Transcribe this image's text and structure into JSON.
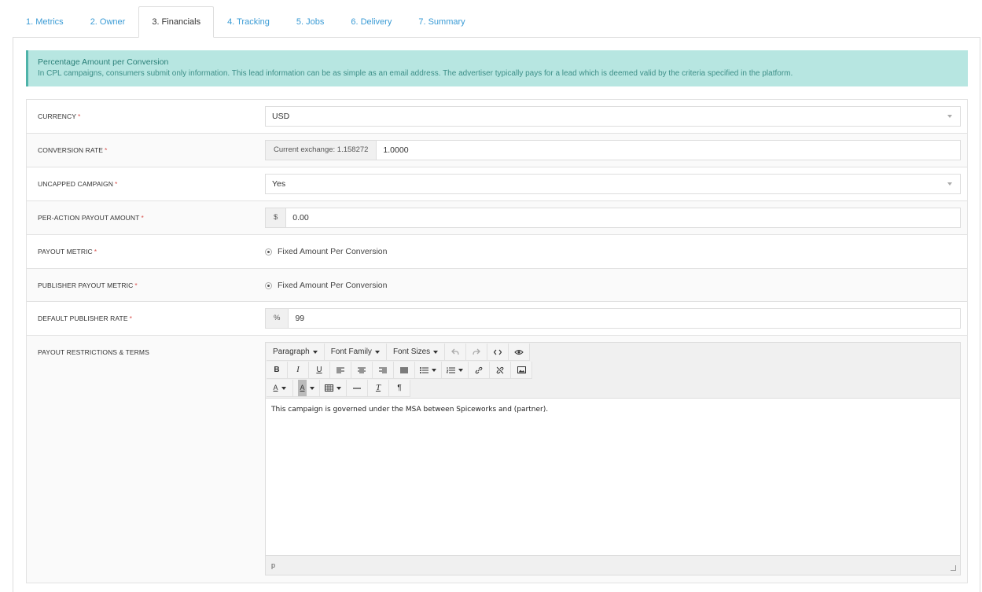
{
  "tabs": [
    {
      "label": "1. Metrics"
    },
    {
      "label": "2. Owner"
    },
    {
      "label": "3. Financials"
    },
    {
      "label": "4. Tracking"
    },
    {
      "label": "5. Jobs"
    },
    {
      "label": "6. Delivery"
    },
    {
      "label": "7. Summary"
    }
  ],
  "alert": {
    "title": "Percentage Amount per Conversion",
    "text": "In CPL campaigns, consumers submit only information. This lead information can be as simple as an email address. The advertiser typically pays for a lead which is deemed valid by the criteria specified in the platform."
  },
  "form": {
    "required_mark": "*",
    "currency": {
      "label": "CURRENCY",
      "value": "USD"
    },
    "conversion_rate": {
      "label": "CONVERSION RATE",
      "addon": "Current exchange: 1.158272",
      "value": "1.0000"
    },
    "uncapped_campaign": {
      "label": "UNCAPPED CAMPAIGN",
      "value": "Yes"
    },
    "payout_amount": {
      "label": "PER-ACTION PAYOUT AMOUNT",
      "addon": "$",
      "value": "0.00"
    },
    "payout_metric": {
      "label": "PAYOUT METRIC",
      "option": "Fixed Amount Per Conversion"
    },
    "publisher_payout_metric": {
      "label": "PUBLISHER PAYOUT METRIC",
      "option": "Fixed Amount Per Conversion"
    },
    "publisher_rate": {
      "label": "DEFAULT PUBLISHER RATE",
      "addon": "%",
      "value": "99"
    },
    "terms": {
      "label": "PAYOUT RESTRICTIONS & TERMS"
    }
  },
  "editor": {
    "paragraph": "Paragraph",
    "font_family": "Font Family",
    "font_sizes": "Font Sizes",
    "bold": "B",
    "italic": "I",
    "underline": "U",
    "text_color": "A",
    "bg_color": "A",
    "clear_format": "T",
    "pilcrow": "¶",
    "content": "This campaign is governed under the MSA between Spiceworks and (partner).",
    "status_path": "p"
  },
  "colors": {
    "accent": "#3a9bd5",
    "alert_bg": "#b7e6e1",
    "alert_border": "#4fb3a9",
    "required": "#d9534f"
  }
}
